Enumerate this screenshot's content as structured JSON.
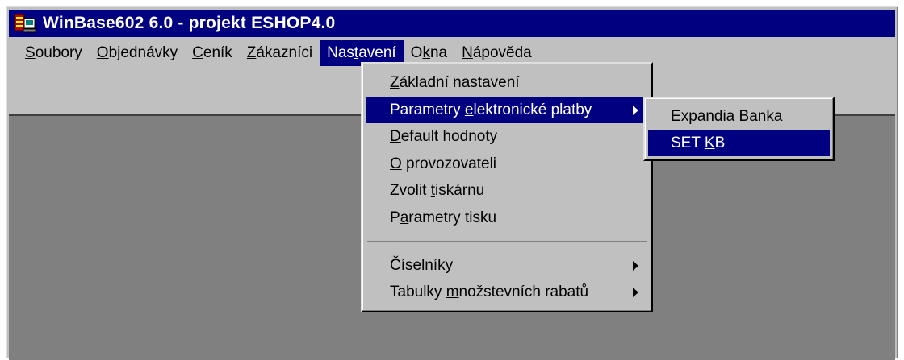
{
  "window": {
    "title": "WinBase602 6.0 - projekt ESHOP4.0"
  },
  "menubar": {
    "items": [
      {
        "pre": "",
        "acc": "S",
        "post": "oubory"
      },
      {
        "pre": "",
        "acc": "O",
        "post": "bjednávky"
      },
      {
        "pre": "",
        "acc": "C",
        "post": "eník"
      },
      {
        "pre": "",
        "acc": "Z",
        "post": "ákazníci"
      },
      {
        "pre": "Nas",
        "acc": "t",
        "post": "avení"
      },
      {
        "pre": "O",
        "acc": "k",
        "post": "na"
      },
      {
        "pre": "",
        "acc": "N",
        "post": "ápověda"
      }
    ]
  },
  "nastaveni_menu": {
    "items": [
      {
        "pre": "",
        "acc": "Z",
        "post": "ákladní nastavení"
      },
      {
        "pre": "Parametry ",
        "acc": "e",
        "post": "lektronické platby"
      },
      {
        "pre": "",
        "acc": "D",
        "post": "efault hodnoty"
      },
      {
        "pre": "",
        "acc": "O",
        "post": " provozovateli"
      },
      {
        "pre": "Zvolit ",
        "acc": "t",
        "post": "iskárnu"
      },
      {
        "pre": "P",
        "acc": "a",
        "post": "rametry tisku"
      },
      {
        "pre": "Číselní",
        "acc": "k",
        "post": "y"
      },
      {
        "pre": "Tabulky ",
        "acc": "m",
        "post": "nožstevních rabatů"
      }
    ]
  },
  "platby_submenu": {
    "items": [
      {
        "pre": "",
        "acc": "E",
        "post": "xpandia Banka"
      },
      {
        "pre": "SET ",
        "acc": "K",
        "post": "B"
      }
    ]
  },
  "colors": {
    "highlight": "#000080",
    "face": "#c0c0c0",
    "workspace": "#808080"
  },
  "icons": {
    "app": "winbase-app-icon",
    "submenu_arrow": "submenu-arrow-icon"
  }
}
